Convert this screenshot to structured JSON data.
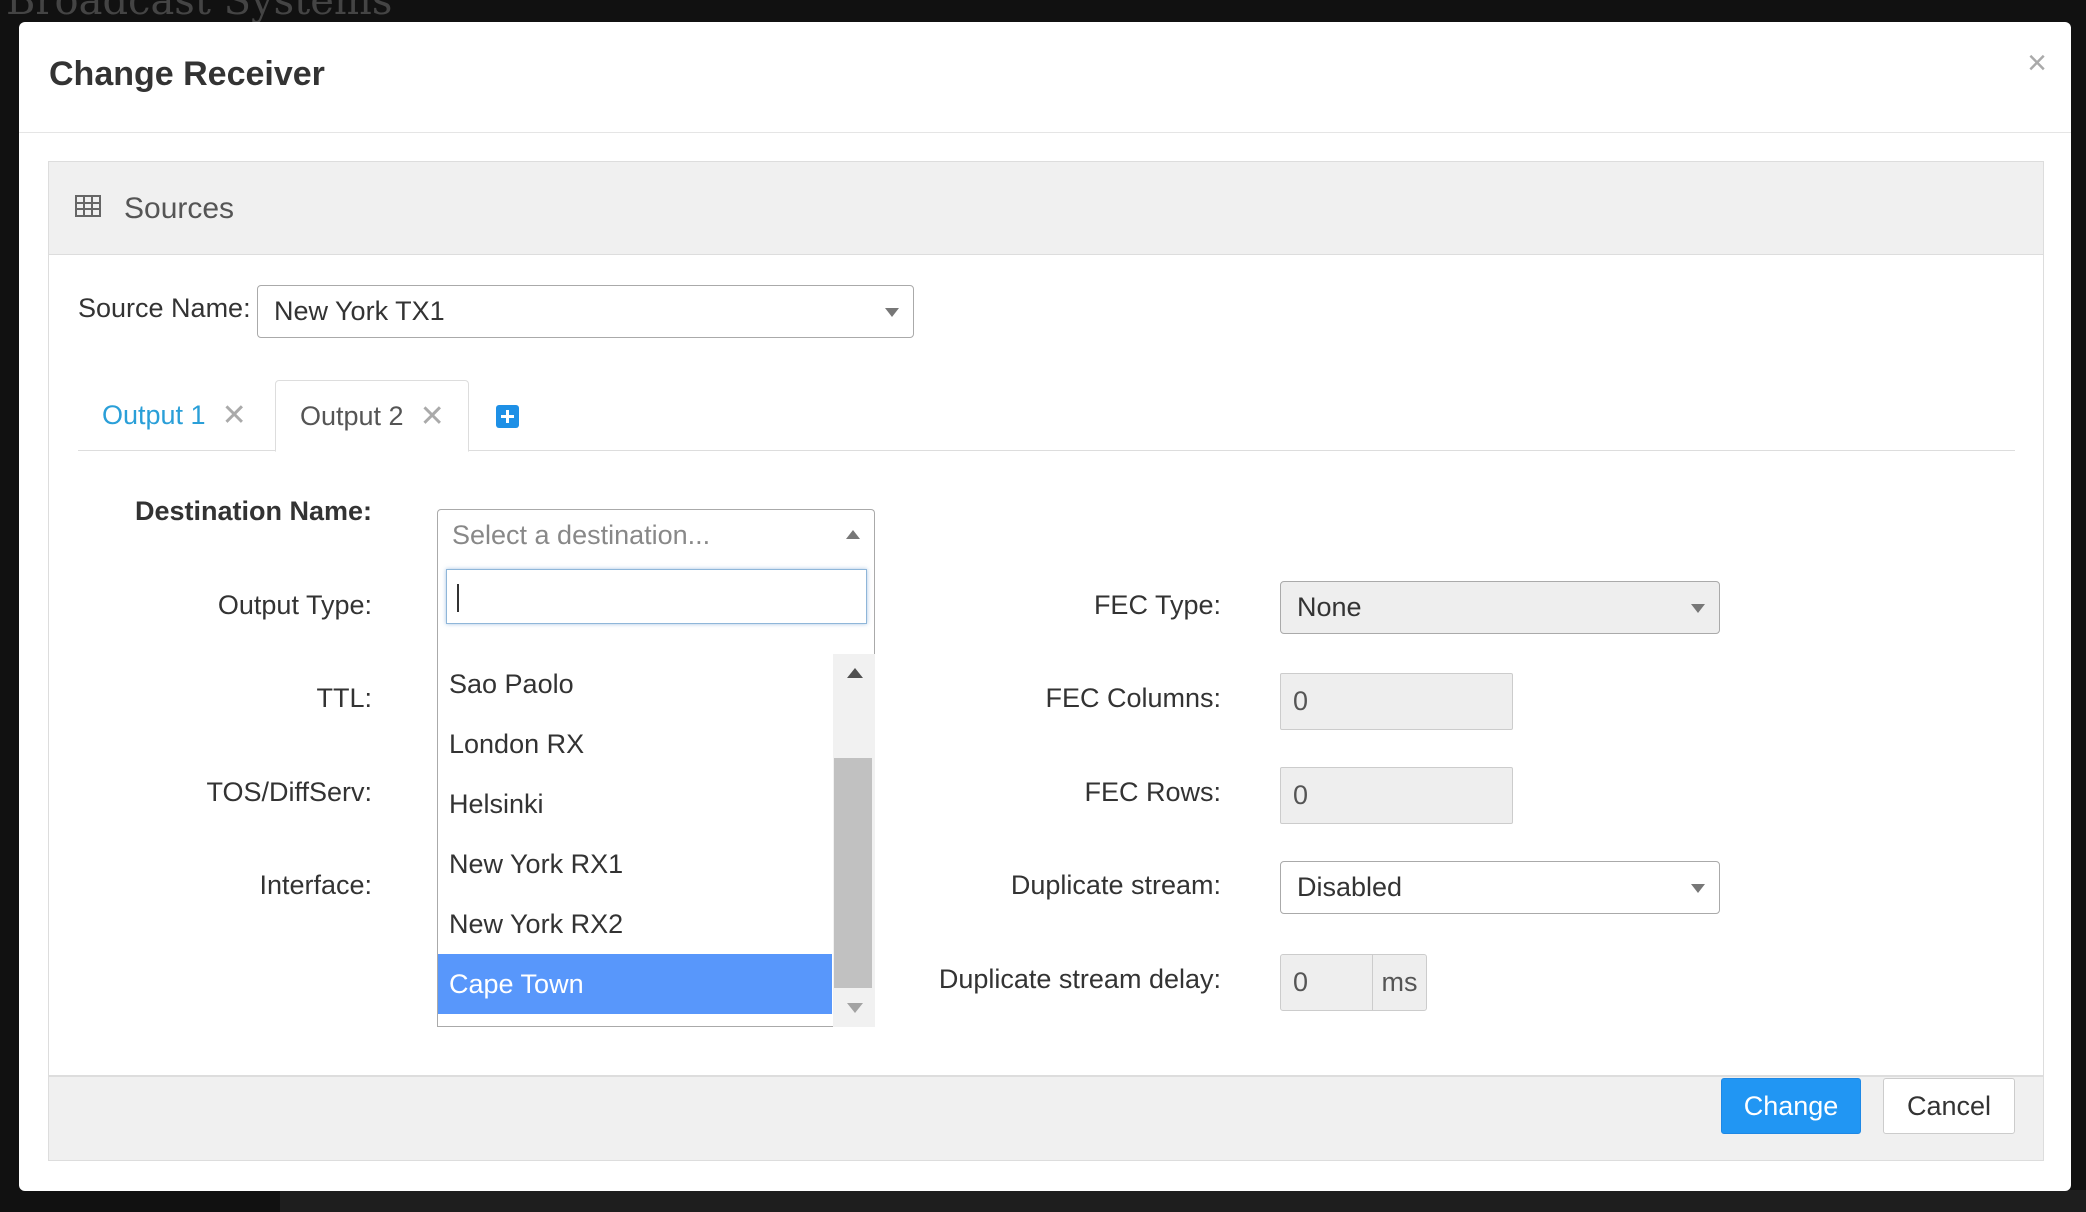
{
  "background": {
    "app_title": "Broadcast Systems"
  },
  "modal": {
    "title": "Change Receiver",
    "close_glyph": "×"
  },
  "panel": {
    "title": "Sources",
    "icon": "table-icon"
  },
  "source": {
    "label": "Source Name:",
    "value": "New York TX1"
  },
  "tabs": [
    {
      "label": "Output 1",
      "close_glyph": "✕",
      "active": false
    },
    {
      "label": "Output 2",
      "close_glyph": "✕",
      "active": true
    }
  ],
  "tab_add_icon": "plus-square-icon",
  "left_form": {
    "destination_label": "Destination Name:",
    "destination_placeholder": "Select a destination...",
    "output_type_label": "Output Type:",
    "ttl_label": "TTL:",
    "tos_label": "TOS/DiffServ:",
    "interface_label": "Interface:"
  },
  "dropdown": {
    "search_value": "",
    "items": [
      "Sao Paolo",
      "London RX",
      "Helsinki",
      "New York RX1",
      "New York RX2",
      "Cape Town"
    ],
    "highlighted": "Cape Town"
  },
  "right_form": {
    "fec_type_label": "FEC Type:",
    "fec_type_value": "None",
    "fec_columns_label": "FEC Columns:",
    "fec_columns_value": "0",
    "fec_rows_label": "FEC Rows:",
    "fec_rows_value": "0",
    "duplicate_stream_label": "Duplicate stream:",
    "duplicate_stream_value": "Disabled",
    "duplicate_delay_label": "Duplicate stream delay:",
    "duplicate_delay_value": "0",
    "duplicate_delay_unit": "ms"
  },
  "footer": {
    "change_label": "Change",
    "cancel_label": "Cancel"
  },
  "colors": {
    "primary": "#2196f3",
    "tab_link": "#2a9fd8",
    "highlight": "#5897fb"
  }
}
